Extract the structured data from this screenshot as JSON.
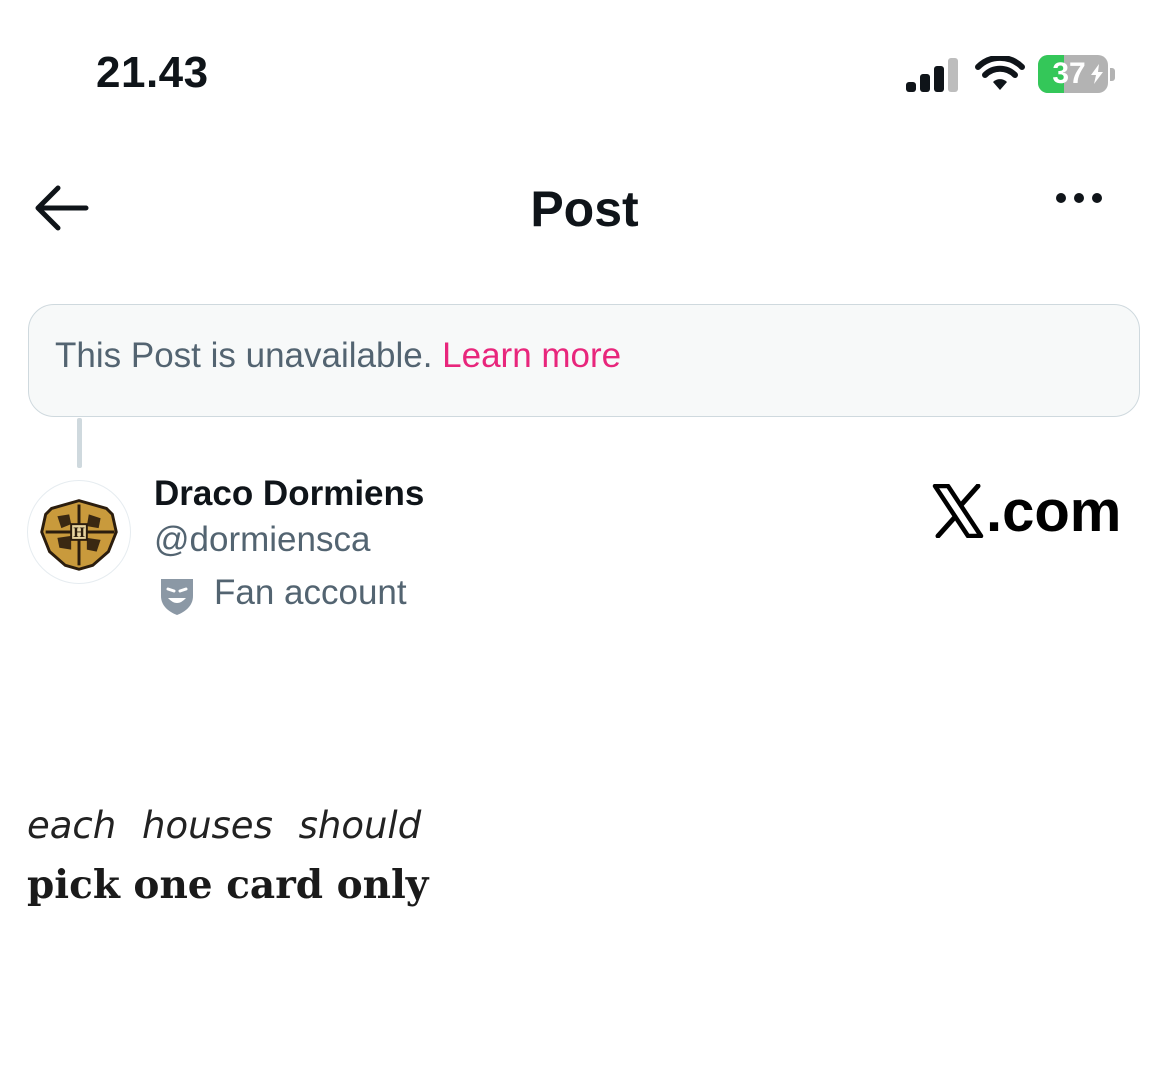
{
  "status_bar": {
    "time": "21.43",
    "battery_percent": "37",
    "battery_level": 0.37,
    "colors": {
      "battery_fill": "#34c759",
      "battery_empty": "#b3b3b3"
    }
  },
  "header": {
    "title": "Post",
    "back_icon": "arrow-left-icon",
    "more_icon": "more-horizontal-icon"
  },
  "notice": {
    "text": "This Post is unavailable.",
    "link": "Learn more",
    "colors": {
      "link": "#e8267c",
      "text": "#536471",
      "background": "#f7f9f9"
    }
  },
  "author": {
    "display_name": "Draco Dormiens",
    "handle": "@dormiensca",
    "label": "Fan account",
    "label_icon": "theater-mask-shield-icon",
    "avatar_icon": "hogwarts-crest-icon"
  },
  "watermark": {
    "text": ".com",
    "icon": "x-logo-icon"
  },
  "post": {
    "line1": "each  houses  should",
    "line2": "pick one card only"
  }
}
